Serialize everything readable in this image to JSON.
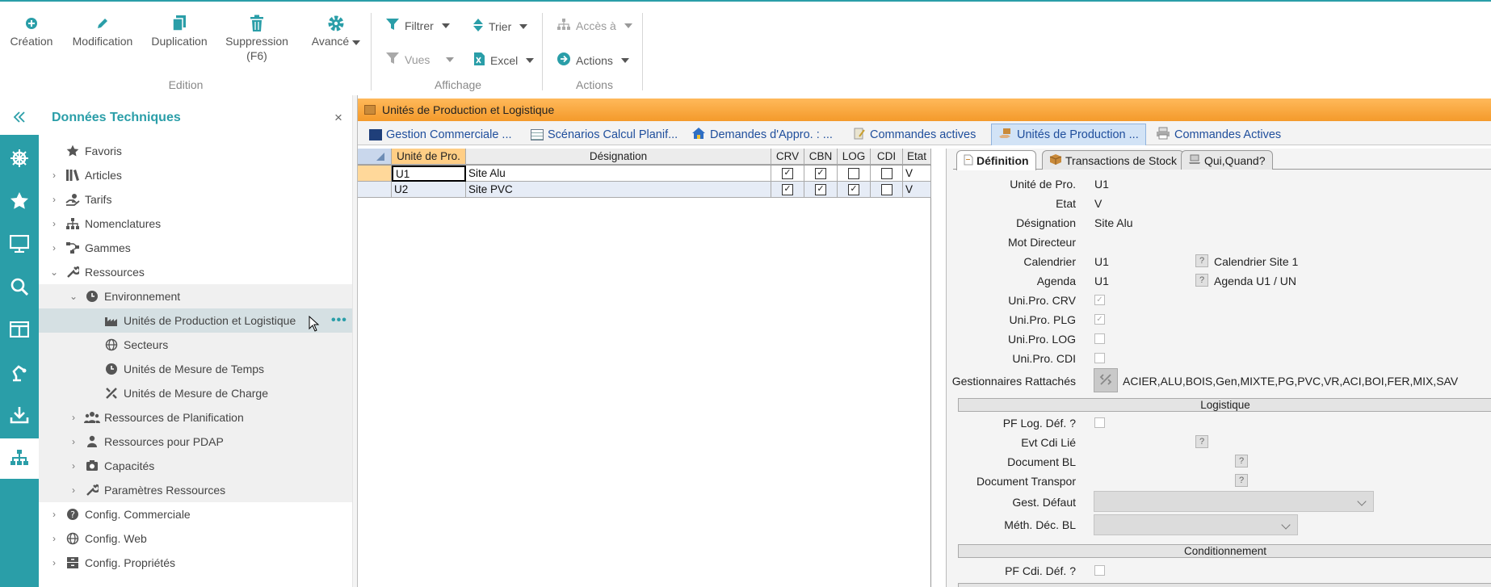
{
  "ribbon": {
    "edition": {
      "label": "Edition",
      "creation": "Création",
      "modification": "Modification",
      "duplication": "Duplication",
      "suppression": "Suppression",
      "suppression_key": "(F6)",
      "avance": "Avancé"
    },
    "affichage": {
      "label": "Affichage",
      "filtrer": "Filtrer",
      "trier": "Trier",
      "vues": "Vues",
      "excel": "Excel"
    },
    "actions": {
      "label": "Actions",
      "acces": "Accès à",
      "actions": "Actions"
    }
  },
  "rail": {
    "icons": [
      "collapse-icon",
      "helm-icon",
      "star-icon",
      "monitor-icon",
      "search-icon",
      "layout-icon",
      "robot-arm-icon",
      "download-icon",
      "hierarchy-icon"
    ],
    "accent": "#2a9ea8"
  },
  "tree": {
    "title": "Données Techniques",
    "close": "×",
    "items": [
      {
        "label": "Favoris"
      },
      {
        "label": "Articles"
      },
      {
        "label": "Tarifs"
      },
      {
        "label": "Nomenclatures"
      },
      {
        "label": "Gammes"
      },
      {
        "label": "Ressources"
      },
      {
        "label": "Environnement"
      },
      {
        "label": "Unités de Production et Logistique"
      },
      {
        "label": "Secteurs"
      },
      {
        "label": "Unités de Mesure de Temps"
      },
      {
        "label": "Unités de Mesure de Charge"
      },
      {
        "label": "Ressources de Planification"
      },
      {
        "label": "Ressources pour PDAP"
      },
      {
        "label": "Capacités"
      },
      {
        "label": "Paramètres Ressources"
      },
      {
        "label": "Config. Commerciale"
      },
      {
        "label": "Config. Web"
      },
      {
        "label": "Config. Propriétés"
      }
    ],
    "more": "•••"
  },
  "window": {
    "title": "Unités de Production et Logistique",
    "tabs": [
      {
        "label": "Gestion Commerciale ..."
      },
      {
        "label": "Scénarios Calcul Planif..."
      },
      {
        "label": "Demandes d'Appro. : ..."
      },
      {
        "label": "Commandes actives"
      },
      {
        "label": "Unités de Production ..."
      },
      {
        "label": "Commandes Actives"
      }
    ]
  },
  "grid": {
    "columns": [
      "Unité de Pro.",
      "Désignation",
      "CRV",
      "CBN",
      "LOG",
      "CDI",
      "Etat"
    ],
    "rows": [
      {
        "code": "U1",
        "designation": "Site Alu",
        "crv": true,
        "cbn": true,
        "log": false,
        "cdi": false,
        "etat": "V"
      },
      {
        "code": "U2",
        "designation": "Site PVC",
        "crv": true,
        "cbn": true,
        "log": true,
        "cdi": false,
        "etat": "V"
      }
    ]
  },
  "detail": {
    "tabs": [
      {
        "label": "Définition"
      },
      {
        "label": "Transactions de Stock"
      },
      {
        "label": "Qui,Quand?"
      }
    ],
    "fields": {
      "unite_label": "Unité de Pro.",
      "unite_value": "U1",
      "etat_label": "Etat",
      "etat_value": "V",
      "designation_label": "Désignation",
      "designation_value": "Site Alu",
      "mot_label": "Mot Directeur",
      "calendrier_label": "Calendrier",
      "calendrier_value": "U1",
      "calendrier_desc": "Calendrier Site 1",
      "agenda_label": "Agenda",
      "agenda_value": "U1",
      "agenda_desc": "Agenda U1 / UN",
      "crv_label": "Uni.Pro. CRV",
      "plg_label": "Uni.Pro. PLG",
      "log_label": "Uni.Pro. LOG",
      "cdi_label": "Uni.Pro. CDI",
      "gest_label": "Gestionnaires Rattachés",
      "gest_value": "ACIER,ALU,BOIS,Gen,MIXTE,PG,PVC,VR,ACI,BOI,FER,MIX,SAV"
    },
    "logistique": {
      "title": "Logistique",
      "pf_log_label": "PF Log. Déf. ?",
      "evt_label": "Evt Cdi Lié",
      "doc_bl_label": "Document BL",
      "doc_transp_label": "Document Transpor",
      "gest_def_label": "Gest. Défaut",
      "meth_label": "Méth. Déc. BL"
    },
    "conditionnement": {
      "title": "Conditionnement",
      "pf_cdi_label": "PF Cdi. Déf. ?"
    },
    "question_mark": "?"
  }
}
